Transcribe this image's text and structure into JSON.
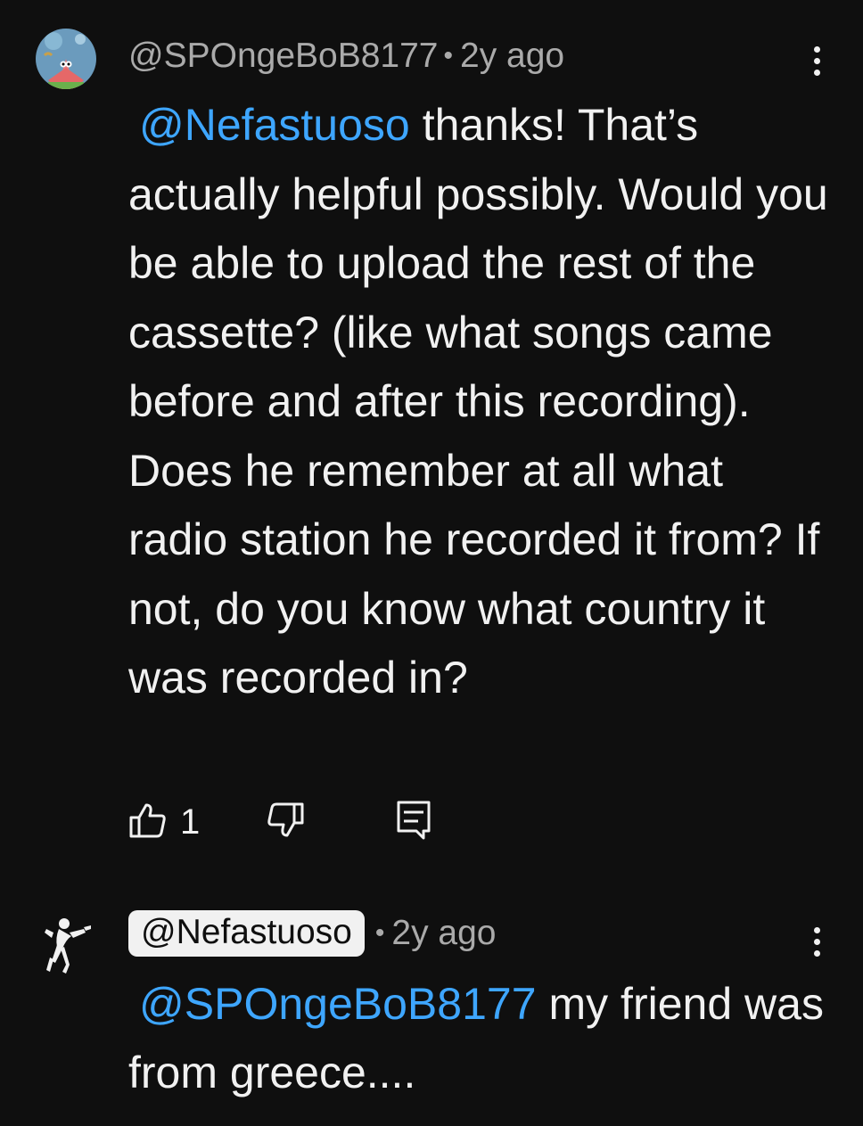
{
  "comments": [
    {
      "author": "@SPOngeBoB8177",
      "time": "2y ago",
      "mention": "@Nefastuoso",
      "text": "thanks! That’s actually helpful possibly. Would you be able to upload the rest of the cassette? (like what songs came before and after this recording). Does he remember at all what radio station he recorded it from? If not, do you know what country it was recorded in?",
      "likes": "1",
      "avatar_icon": "patrick-star-avatar-icon"
    },
    {
      "author": "@Nefastuoso",
      "time": "2y ago",
      "mention": "@SPOngeBoB8177",
      "text": "my friend was from greece....",
      "avatar_icon": "dancing-figure-avatar-icon"
    }
  ],
  "separator": "•",
  "icons": {
    "like": "thumb-up-icon",
    "dislike": "thumb-down-icon",
    "reply": "reply-comment-icon",
    "menu": "more-vert-icon"
  },
  "colors": {
    "background": "#0f0f0f",
    "text": "#f1f1f1",
    "meta": "#aaaaaa",
    "mention": "#3ea6ff"
  }
}
